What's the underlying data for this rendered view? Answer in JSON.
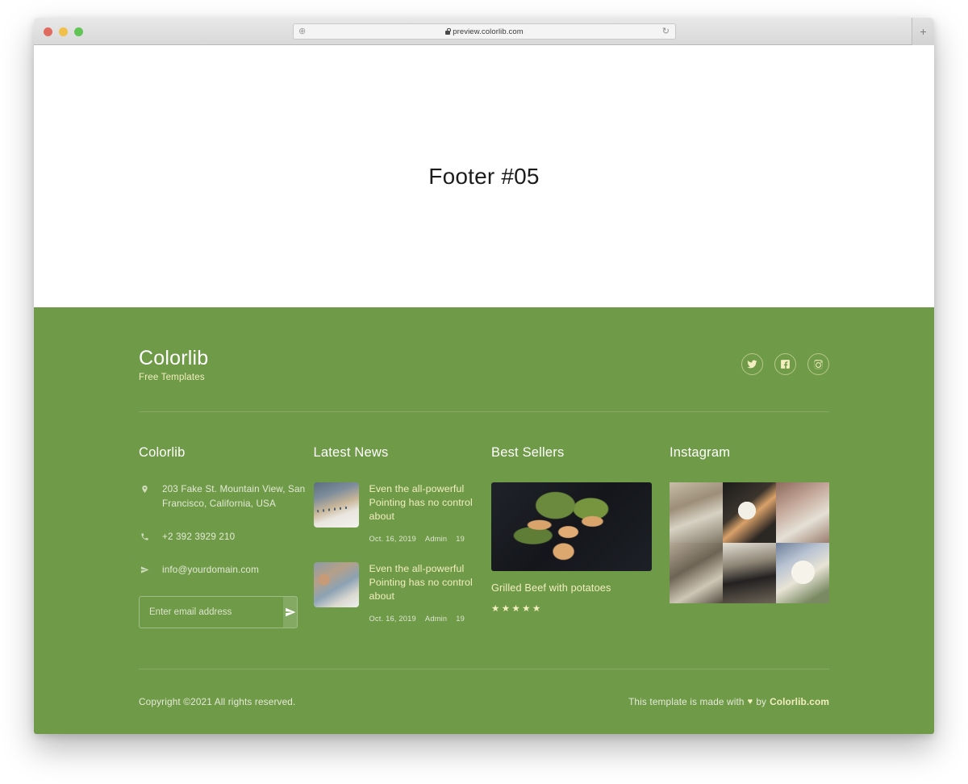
{
  "browser": {
    "url": "preview.colorlib.com",
    "lock_icon": "lock-icon",
    "left_icon": "add-page-icon",
    "reload_icon": "reload-icon",
    "new_tab_label": "+"
  },
  "hero": {
    "title": "Footer #05"
  },
  "footer": {
    "brand": {
      "name": "Colorlib",
      "tagline": "Free Templates"
    },
    "social": [
      {
        "name": "twitter-icon",
        "label": "Twitter"
      },
      {
        "name": "facebook-icon",
        "label": "Facebook"
      },
      {
        "name": "instagram-icon",
        "label": "Instagram"
      }
    ],
    "contact": {
      "title": "Colorlib",
      "address": "203 Fake St. Mountain View, San Francisco, California, USA",
      "phone": "+2 392 3929 210",
      "email": "info@yourdomain.com",
      "subscribe_placeholder": "Enter email address",
      "subscribe_value": "",
      "submit_icon": "paper-plane-icon"
    },
    "news": {
      "title": "Latest News",
      "items": [
        {
          "title": "Even the all-powerful Pointing has no control about",
          "date": "Oct. 16, 2019",
          "author": "Admin",
          "comments": "19"
        },
        {
          "title": "Even the all-powerful Pointing has no control about",
          "date": "Oct. 16, 2019",
          "author": "Admin",
          "comments": "19"
        }
      ]
    },
    "best_sellers": {
      "title": "Best Sellers",
      "product_name": "Grilled Beef with potatoes",
      "rating": "★★★★★"
    },
    "instagram": {
      "title": "Instagram",
      "photo_count": 6
    },
    "bottom": {
      "copyright": "Copyright ©2021 All rights reserved.",
      "made_prefix": "This template is made with",
      "heart": "♥",
      "made_by": "by",
      "made_link": "Colorlib.com"
    }
  },
  "colors": {
    "footer_green": "#6f9a47",
    "cream": "#f2eec0",
    "white": "#ffffff"
  }
}
